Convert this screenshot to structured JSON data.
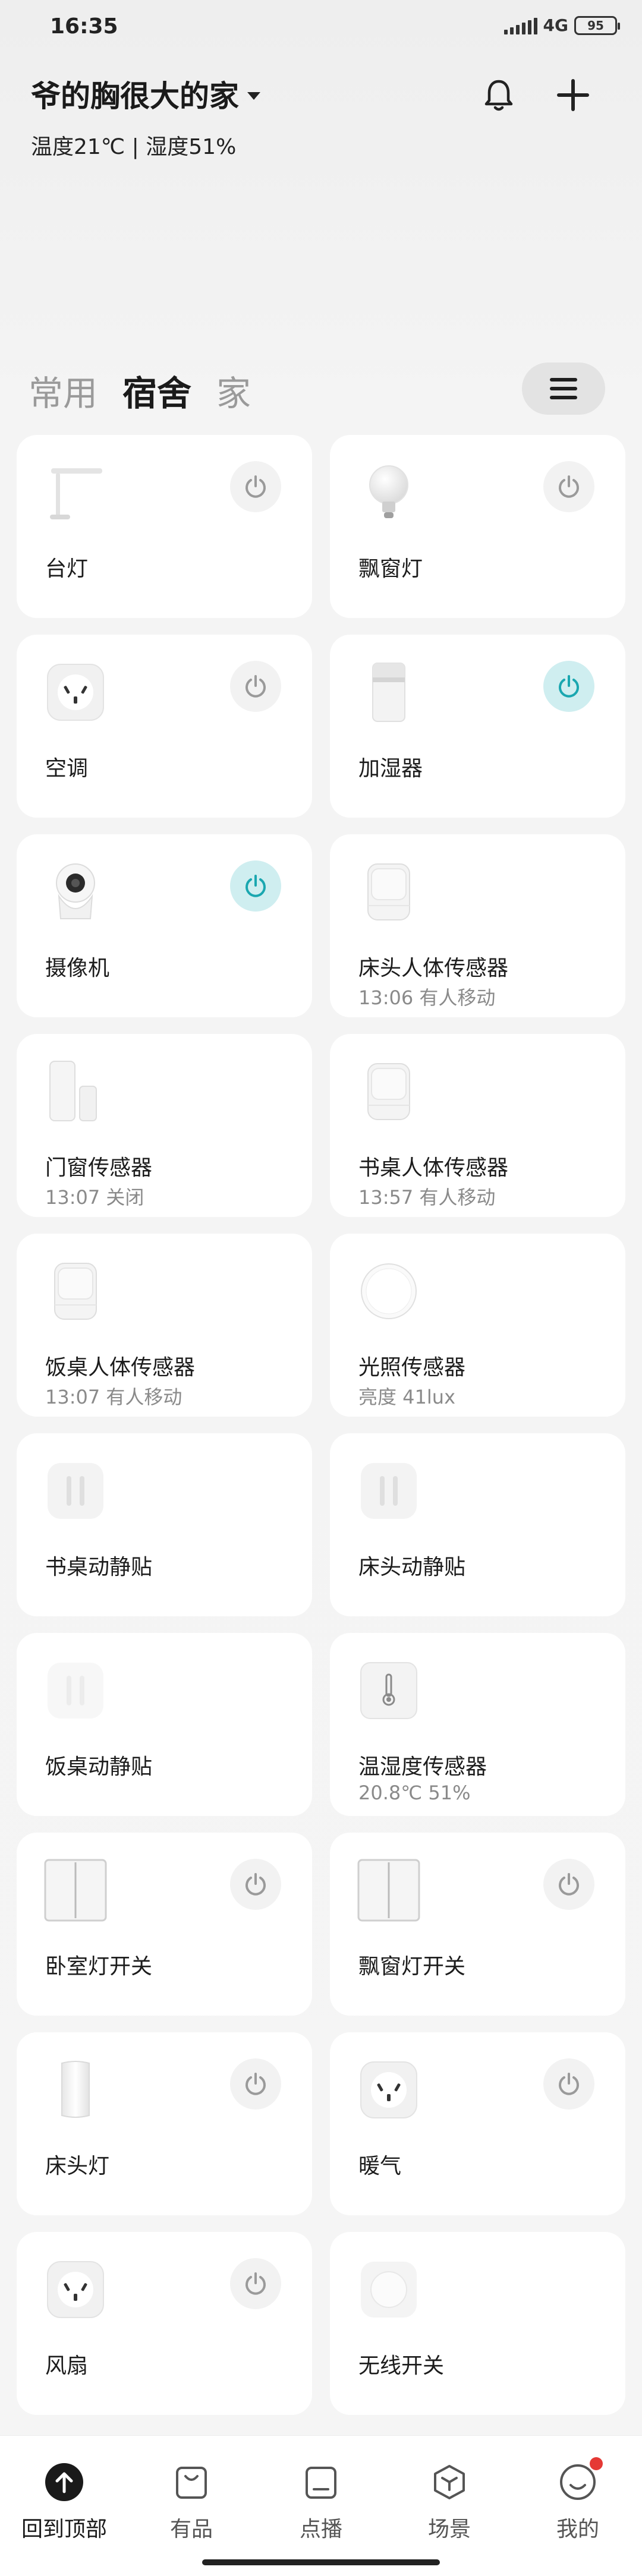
{
  "status": {
    "time": "16:35",
    "network": "4G",
    "battery": "95"
  },
  "header": {
    "home_name": "爷的胸很大的家",
    "env": "温度21℃ | 湿度51%"
  },
  "tabs": [
    {
      "label": "常用",
      "active": false
    },
    {
      "label": "宿舍",
      "active": true
    },
    {
      "label": "家",
      "active": false
    }
  ],
  "devices": [
    {
      "label": "台灯",
      "sub": "",
      "icon": "desk-lamp-icon",
      "power": "off"
    },
    {
      "label": "飘窗灯",
      "sub": "",
      "icon": "bulb-icon",
      "power": "off"
    },
    {
      "label": "空调",
      "sub": "",
      "icon": "smart-plug-icon",
      "power": "off"
    },
    {
      "label": "加湿器",
      "sub": "",
      "icon": "humidifier-icon",
      "power": "on"
    },
    {
      "label": "摄像机",
      "sub": "",
      "icon": "camera-icon",
      "power": "on"
    },
    {
      "label": "床头人体传感器",
      "sub": "13:06 有人移动",
      "icon": "motion-sensor-icon",
      "power": "none"
    },
    {
      "label": "门窗传感器",
      "sub": "13:07 关闭",
      "icon": "door-sensor-icon",
      "power": "none"
    },
    {
      "label": "书桌人体传感器",
      "sub": "13:57 有人移动",
      "icon": "motion-sensor-icon",
      "power": "none"
    },
    {
      "label": "饭桌人体传感器",
      "sub": "13:07 有人移动",
      "icon": "motion-sensor-icon",
      "power": "none"
    },
    {
      "label": "光照传感器",
      "sub": "亮度 41lux",
      "icon": "light-sensor-icon",
      "power": "none"
    },
    {
      "label": "书桌动静贴",
      "sub": "",
      "icon": "vibration-sticker-icon",
      "power": "none"
    },
    {
      "label": "床头动静贴",
      "sub": "",
      "icon": "vibration-sticker-icon",
      "power": "none"
    },
    {
      "label": "饭桌动静贴",
      "sub": "",
      "icon": "vibration-sticker-faded-icon",
      "power": "none"
    },
    {
      "label": "温湿度传感器",
      "sub": "20.8℃ 51%",
      "icon": "thermometer-icon",
      "power": "none"
    },
    {
      "label": "卧室灯开关",
      "sub": "",
      "icon": "wall-switch-icon",
      "power": "off"
    },
    {
      "label": "飘窗灯开关",
      "sub": "",
      "icon": "wall-switch-icon",
      "power": "off"
    },
    {
      "label": "床头灯",
      "sub": "",
      "icon": "bedside-lamp-icon",
      "power": "off"
    },
    {
      "label": "暖气",
      "sub": "",
      "icon": "smart-plug-icon",
      "power": "off"
    },
    {
      "label": "风扇",
      "sub": "",
      "icon": "smart-plug-icon",
      "power": "off"
    },
    {
      "label": "无线开关",
      "sub": "",
      "icon": "wireless-button-icon",
      "power": "none"
    }
  ],
  "colors": {
    "power_on": "#1aa7b0",
    "power_on_bg": "#cfeef0",
    "power_off": "#9a9a9a"
  },
  "bottom_nav": [
    {
      "label": "回到顶部",
      "icon": "up-arrow-icon"
    },
    {
      "label": "有品",
      "icon": "shopping-bag-icon"
    },
    {
      "label": "点播",
      "icon": "tv-icon"
    },
    {
      "label": "场景",
      "icon": "cube-icon"
    },
    {
      "label": "我的",
      "icon": "profile-icon",
      "badge": true
    }
  ]
}
